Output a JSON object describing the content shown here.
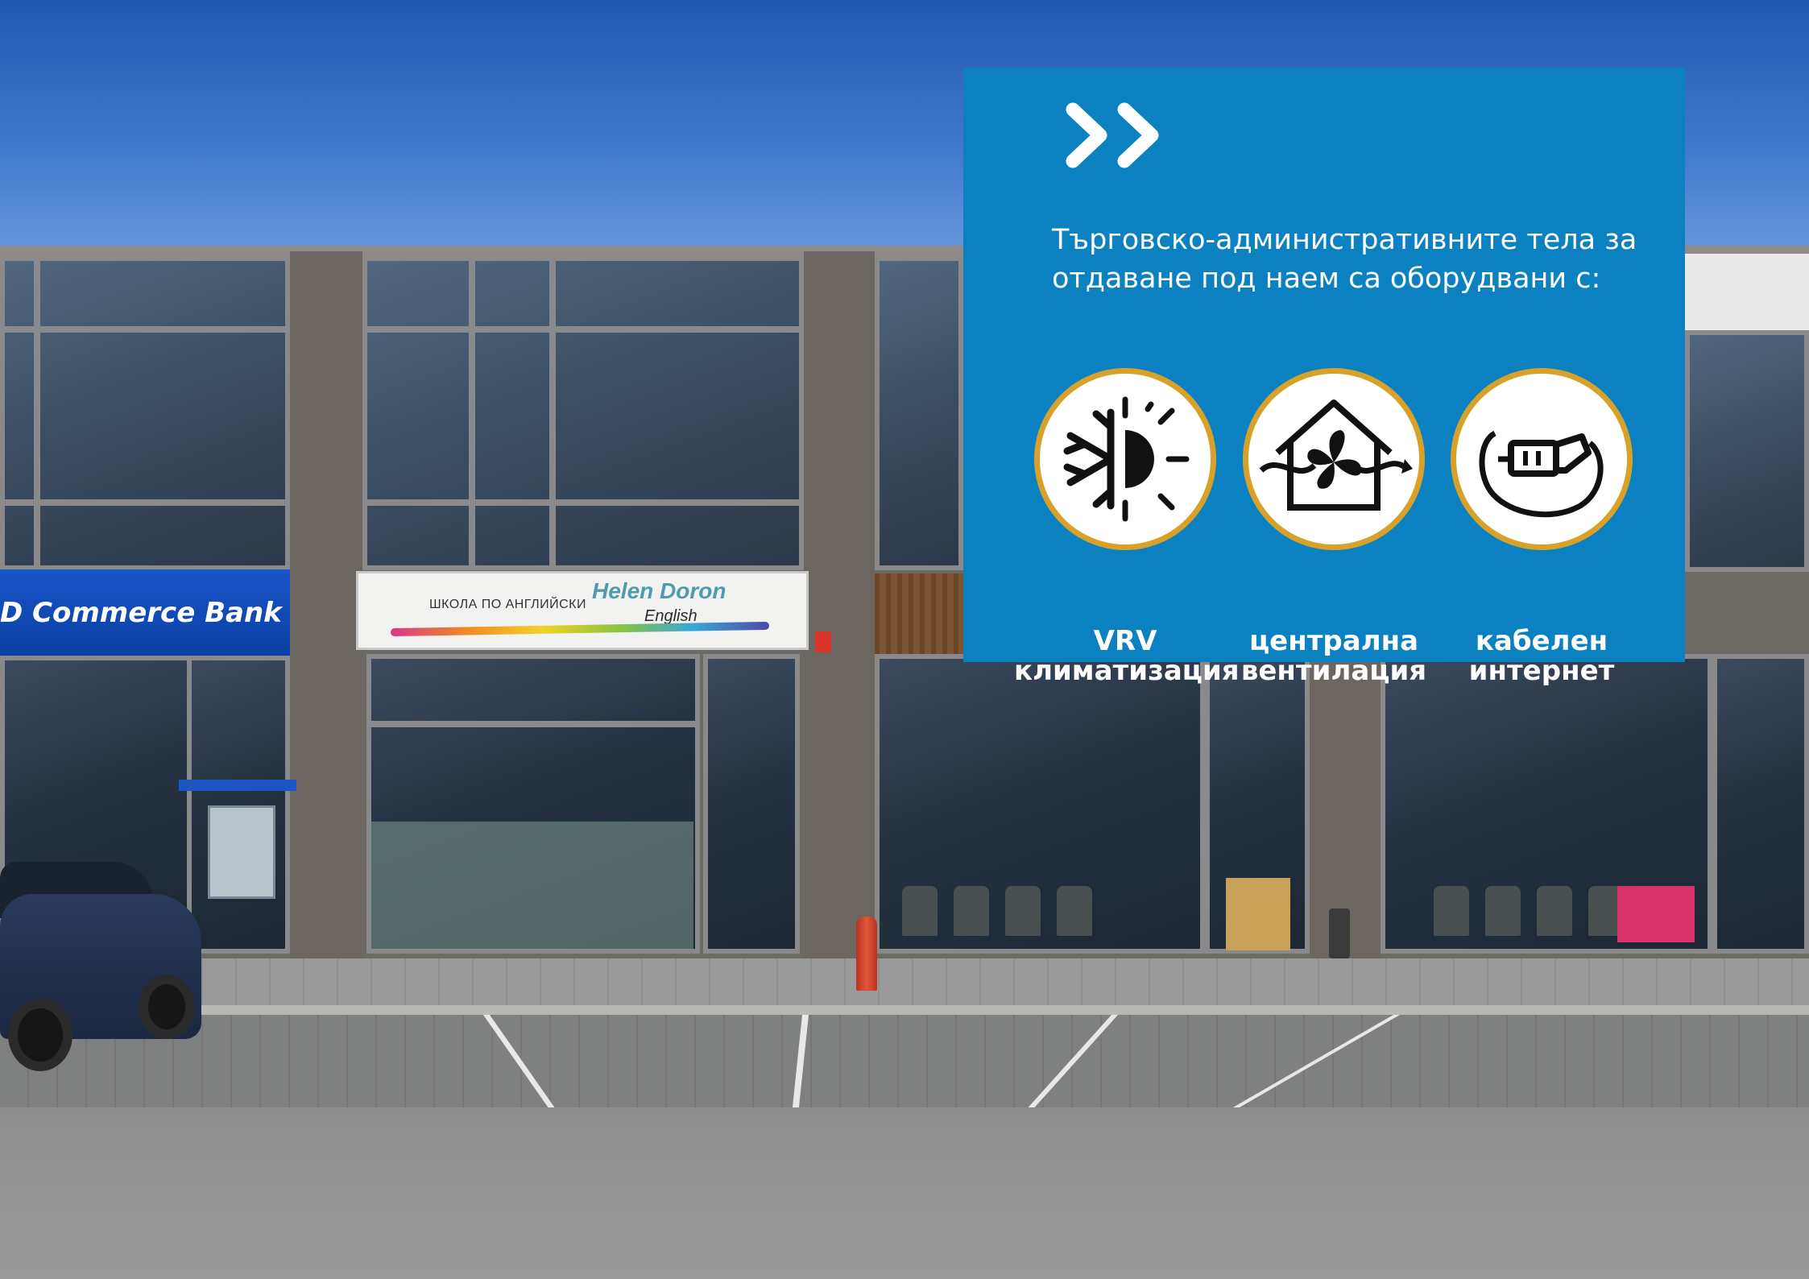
{
  "panel": {
    "background": "#0c81c2",
    "accent_ring": "#d8a22a",
    "chevron_icon": "double-chevron-right-icon",
    "intro_line1": "Търговско-административните тела за",
    "intro_line2": "отдаване под наем са оборудвани с:",
    "features": [
      {
        "icon": "snowflake-sun-icon",
        "line1": "VRV",
        "line2": "климатизация"
      },
      {
        "icon": "house-ventilation-fan-icon",
        "line1": "централна",
        "line2": "вентилация"
      },
      {
        "icon": "cable-plug-icon",
        "line1": "кабелен",
        "line2": "интернет"
      }
    ]
  },
  "photo": {
    "bank_sign": "D Commerce Bank",
    "school_sign_label": "ШКОЛА ПО АНГЛИЙСКИ",
    "school_brand": "Helen Doron",
    "school_brand_sub": "English"
  }
}
